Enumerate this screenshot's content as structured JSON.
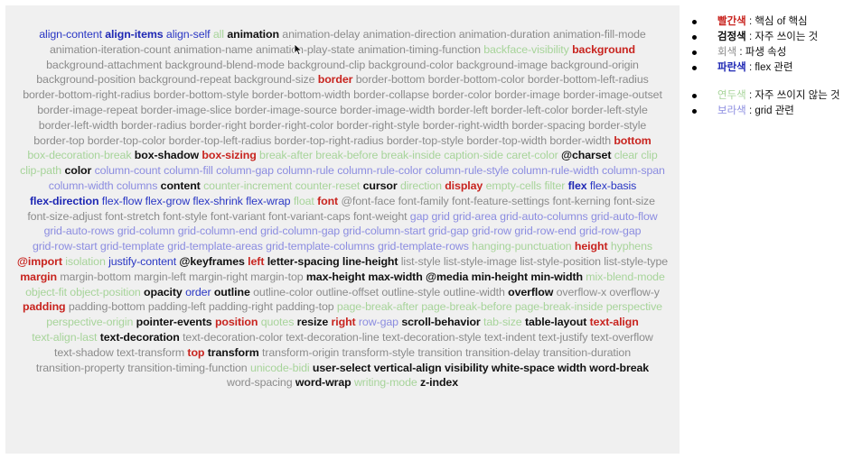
{
  "colors": {
    "red": "#c8241f",
    "black": "#111111",
    "gray": "#8b8b8b",
    "blue": "#1f28b4",
    "light_blue": "#2a37c4",
    "green": "#a7d49a",
    "purple": "#8b8ce0",
    "panel_bg": "#f0f0f0"
  },
  "legend": {
    "items": [
      {
        "color_word": "빨간색",
        "desc": " : 핵심 of 핵심",
        "swatch": "red"
      },
      {
        "color_word": "검정색",
        "desc": " : 자주 쓰이는 것",
        "swatch": "black"
      },
      {
        "color_word": "회색",
        "desc": " : 파생 속성",
        "swatch": "gray"
      },
      {
        "color_word": "파란색",
        "desc": " : flex 관련",
        "swatch": "blue"
      },
      {
        "color_word": "연두색",
        "desc": " : 자주 쓰이지 않는 것",
        "swatch": "green"
      },
      {
        "color_word": "보라색",
        "desc": " : grid 관련",
        "swatch": "purple"
      }
    ]
  },
  "cursor_icon": "mouse-pointer-icon",
  "cloud": [
    [
      "align-content",
      "lblue"
    ],
    [
      "align-items",
      "blue"
    ],
    [
      "align-self",
      "lblue"
    ],
    [
      "all",
      "green"
    ],
    [
      "animation",
      "black"
    ],
    [
      "animation-delay",
      "gray"
    ],
    [
      "animation-direction",
      "gray"
    ],
    [
      "animation-duration",
      "gray"
    ],
    [
      "animation-fill-mode",
      "gray"
    ],
    [
      "animation-iteration-count",
      "gray"
    ],
    [
      "animation-name",
      "gray"
    ],
    [
      "animation-play-state",
      "gray"
    ],
    [
      "animation-timing-function",
      "gray"
    ],
    [
      "backface-visibility",
      "green"
    ],
    [
      "background",
      "red"
    ],
    [
      "background-attachment",
      "gray"
    ],
    [
      "background-blend-mode",
      "gray"
    ],
    [
      "background-clip",
      "gray"
    ],
    [
      "background-color",
      "gray"
    ],
    [
      "background-image",
      "gray"
    ],
    [
      "background-origin",
      "gray"
    ],
    [
      "background-position",
      "gray"
    ],
    [
      "background-repeat",
      "gray"
    ],
    [
      "background-size",
      "gray"
    ],
    [
      "border",
      "red"
    ],
    [
      "border-bottom",
      "gray"
    ],
    [
      "border-bottom-color",
      "gray"
    ],
    [
      "border-bottom-left-radius",
      "gray"
    ],
    [
      "border-bottom-right-radius",
      "gray"
    ],
    [
      "border-bottom-style",
      "gray"
    ],
    [
      "border-bottom-width",
      "gray"
    ],
    [
      "border-collapse",
      "gray"
    ],
    [
      "border-color",
      "gray"
    ],
    [
      "border-image",
      "gray"
    ],
    [
      "border-image-outset",
      "gray"
    ],
    [
      "border-image-repeat",
      "gray"
    ],
    [
      "border-image-slice",
      "gray"
    ],
    [
      "border-image-source",
      "gray"
    ],
    [
      "border-image-width",
      "gray"
    ],
    [
      "border-left",
      "gray"
    ],
    [
      "border-left-color",
      "gray"
    ],
    [
      "border-left-style",
      "gray"
    ],
    [
      "border-left-width",
      "gray"
    ],
    [
      "border-radius",
      "gray"
    ],
    [
      "border-right",
      "gray"
    ],
    [
      "border-right-color",
      "gray"
    ],
    [
      "border-right-style",
      "gray"
    ],
    [
      "border-right-width",
      "gray"
    ],
    [
      "border-spacing",
      "gray"
    ],
    [
      "border-style",
      "gray"
    ],
    [
      "border-top",
      "gray"
    ],
    [
      "border-top-color",
      "gray"
    ],
    [
      "border-top-left-radius",
      "gray"
    ],
    [
      "border-top-right-radius",
      "gray"
    ],
    [
      "border-top-style",
      "gray"
    ],
    [
      "border-top-width",
      "gray"
    ],
    [
      "border-width",
      "gray"
    ],
    [
      "bottom",
      "red"
    ],
    [
      "box-decoration-break",
      "green"
    ],
    [
      "box-shadow",
      "black"
    ],
    [
      "box-sizing",
      "red"
    ],
    [
      "break-after",
      "green"
    ],
    [
      "break-before",
      "green"
    ],
    [
      "break-inside",
      "green"
    ],
    [
      "caption-side",
      "green"
    ],
    [
      "caret-color",
      "green"
    ],
    [
      "@charset",
      "black"
    ],
    [
      "clear",
      "green"
    ],
    [
      "clip",
      "green"
    ],
    [
      "clip-path",
      "green"
    ],
    [
      "color",
      "black"
    ],
    [
      "column-count",
      "purple"
    ],
    [
      "column-fill",
      "purple"
    ],
    [
      "column-gap",
      "purple"
    ],
    [
      "column-rule",
      "purple"
    ],
    [
      "column-rule-color",
      "purple"
    ],
    [
      "column-rule-style",
      "purple"
    ],
    [
      "column-rule-width",
      "purple"
    ],
    [
      "column-span",
      "purple"
    ],
    [
      "column-width",
      "purple"
    ],
    [
      "columns",
      "purple"
    ],
    [
      "content",
      "black"
    ],
    [
      "counter-increment",
      "green"
    ],
    [
      "counter-reset",
      "green"
    ],
    [
      "cursor",
      "black"
    ],
    [
      "direction",
      "green"
    ],
    [
      "display",
      "red"
    ],
    [
      "empty-cells",
      "green"
    ],
    [
      "filter",
      "green"
    ],
    [
      "flex",
      "blue"
    ],
    [
      "flex-basis",
      "lblue"
    ],
    [
      "flex-direction",
      "blue"
    ],
    [
      "flex-flow",
      "lblue"
    ],
    [
      "flex-grow",
      "lblue"
    ],
    [
      "flex-shrink",
      "lblue"
    ],
    [
      "flex-wrap",
      "lblue"
    ],
    [
      "float",
      "green"
    ],
    [
      "font",
      "red"
    ],
    [
      "@font-face",
      "gray"
    ],
    [
      "font-family",
      "gray"
    ],
    [
      "font-feature-settings",
      "gray"
    ],
    [
      "font-kerning",
      "gray"
    ],
    [
      "font-size",
      "gray"
    ],
    [
      "font-size-adjust",
      "gray"
    ],
    [
      "font-stretch",
      "gray"
    ],
    [
      "font-style",
      "gray"
    ],
    [
      "font-variant",
      "gray"
    ],
    [
      "font-variant-caps",
      "gray"
    ],
    [
      "font-weight",
      "gray"
    ],
    [
      "gap",
      "purple"
    ],
    [
      "grid",
      "purple"
    ],
    [
      "grid-area",
      "purple"
    ],
    [
      "grid-auto-columns",
      "purple"
    ],
    [
      "grid-auto-flow",
      "purple"
    ],
    [
      "grid-auto-rows",
      "purple"
    ],
    [
      "grid-column",
      "purple"
    ],
    [
      "grid-column-end",
      "purple"
    ],
    [
      "grid-column-gap",
      "purple"
    ],
    [
      "grid-column-start",
      "purple"
    ],
    [
      "grid-gap",
      "purple"
    ],
    [
      "grid-row",
      "purple"
    ],
    [
      "grid-row-end",
      "purple"
    ],
    [
      "grid-row-gap",
      "purple"
    ],
    [
      "grid-row-start",
      "purple"
    ],
    [
      "grid-template",
      "purple"
    ],
    [
      "grid-template-areas",
      "purple"
    ],
    [
      "grid-template-columns",
      "purple"
    ],
    [
      "grid-template-rows",
      "purple"
    ],
    [
      "hanging-punctuation",
      "green"
    ],
    [
      "height",
      "red"
    ],
    [
      "hyphens",
      "green"
    ],
    [
      "@import",
      "red"
    ],
    [
      "isolation",
      "green"
    ],
    [
      "justify-content",
      "lblue"
    ],
    [
      "@keyframes",
      "black"
    ],
    [
      "left",
      "red"
    ],
    [
      "letter-spacing",
      "black"
    ],
    [
      "line-height",
      "black"
    ],
    [
      "list-style",
      "gray"
    ],
    [
      "list-style-image",
      "gray"
    ],
    [
      "list-style-position",
      "gray"
    ],
    [
      "list-style-type",
      "gray"
    ],
    [
      "margin",
      "red"
    ],
    [
      "margin-bottom",
      "gray"
    ],
    [
      "margin-left",
      "gray"
    ],
    [
      "margin-right",
      "gray"
    ],
    [
      "margin-top",
      "gray"
    ],
    [
      "max-height",
      "black"
    ],
    [
      "max-width",
      "black"
    ],
    [
      "@media",
      "black"
    ],
    [
      "min-height",
      "black"
    ],
    [
      "min-width",
      "black"
    ],
    [
      "mix-blend-mode",
      "green"
    ],
    [
      "object-fit",
      "green"
    ],
    [
      "object-position",
      "green"
    ],
    [
      "opacity",
      "black"
    ],
    [
      "order",
      "lblue"
    ],
    [
      "outline",
      "black"
    ],
    [
      "outline-color",
      "gray"
    ],
    [
      "outline-offset",
      "gray"
    ],
    [
      "outline-style",
      "gray"
    ],
    [
      "outline-width",
      "gray"
    ],
    [
      "overflow",
      "black"
    ],
    [
      "overflow-x",
      "gray"
    ],
    [
      "overflow-y",
      "gray"
    ],
    [
      "padding",
      "red"
    ],
    [
      "padding-bottom",
      "gray"
    ],
    [
      "padding-left",
      "gray"
    ],
    [
      "padding-right",
      "gray"
    ],
    [
      "padding-top",
      "gray"
    ],
    [
      "page-break-after",
      "green"
    ],
    [
      "page-break-before",
      "green"
    ],
    [
      "page-break-inside",
      "green"
    ],
    [
      "perspective",
      "green"
    ],
    [
      "perspective-origin",
      "green"
    ],
    [
      "pointer-events",
      "black"
    ],
    [
      "position",
      "red"
    ],
    [
      "quotes",
      "green"
    ],
    [
      "resize",
      "black"
    ],
    [
      "right",
      "red"
    ],
    [
      "row-gap",
      "purple"
    ],
    [
      "scroll-behavior",
      "black"
    ],
    [
      "tab-size",
      "green"
    ],
    [
      "table-layout",
      "black"
    ],
    [
      "text-align",
      "red"
    ],
    [
      "text-align-last",
      "green"
    ],
    [
      "text-decoration",
      "black"
    ],
    [
      "text-decoration-color",
      "gray"
    ],
    [
      "text-decoration-line",
      "gray"
    ],
    [
      "text-decoration-style",
      "gray"
    ],
    [
      "text-indent",
      "gray"
    ],
    [
      "text-justify",
      "gray"
    ],
    [
      "text-overflow",
      "gray"
    ],
    [
      "text-shadow",
      "gray"
    ],
    [
      "text-transform",
      "gray"
    ],
    [
      "top",
      "red"
    ],
    [
      "transform",
      "black"
    ],
    [
      "transform-origin",
      "gray"
    ],
    [
      "transform-style",
      "gray"
    ],
    [
      "transition",
      "gray"
    ],
    [
      "transition-delay",
      "gray"
    ],
    [
      "transition-duration",
      "gray"
    ],
    [
      "transition-property",
      "gray"
    ],
    [
      "transition-timing-function",
      "gray"
    ],
    [
      "unicode-bidi",
      "green"
    ],
    [
      "user-select",
      "black"
    ],
    [
      "vertical-align",
      "black"
    ],
    [
      "visibility",
      "black"
    ],
    [
      "white-space",
      "black"
    ],
    [
      "width",
      "black"
    ],
    [
      "word-break",
      "black"
    ],
    [
      "word-spacing",
      "gray"
    ],
    [
      "word-wrap",
      "black"
    ],
    [
      "writing-mode",
      "green"
    ],
    [
      "z-index",
      "black"
    ]
  ]
}
